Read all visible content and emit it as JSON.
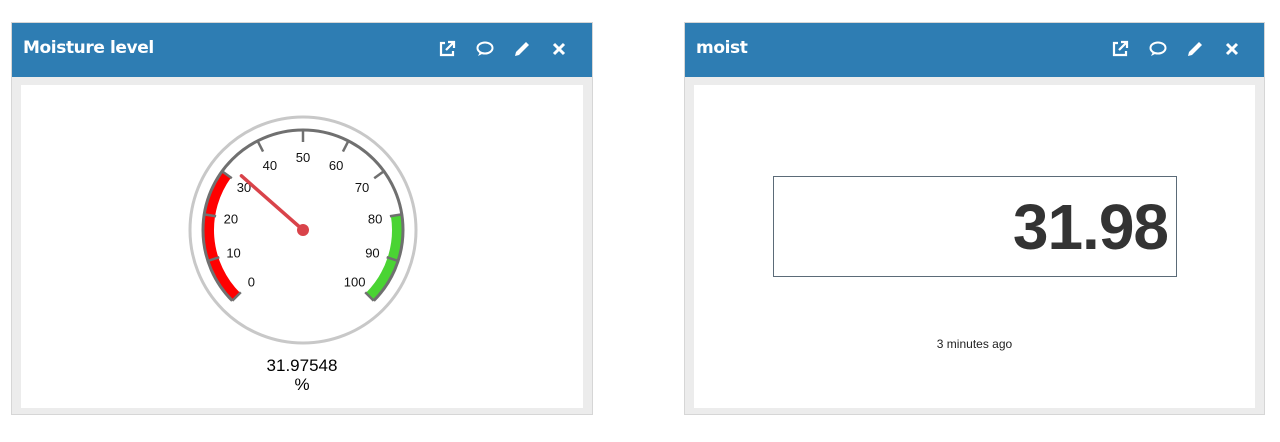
{
  "widgets": [
    {
      "title": "Moisture level",
      "type": "gauge",
      "value": "31.97548",
      "unit": "%",
      "gauge": {
        "min": 0,
        "max": 100,
        "major_ticks": [
          "0",
          "10",
          "20",
          "30",
          "40",
          "50",
          "60",
          "70",
          "80",
          "90",
          "100"
        ],
        "red_range": [
          0,
          30
        ],
        "green_range": [
          80,
          100
        ],
        "red_color": "#ff0000",
        "green_color": "#4ad433",
        "needle_color": "#d9434a"
      },
      "tools": [
        "external-link-icon",
        "comment-icon",
        "pencil-icon",
        "close-icon"
      ]
    },
    {
      "title": "moist",
      "type": "value",
      "value": "31.98",
      "timestamp": "3 minutes ago",
      "tools": [
        "external-link-icon",
        "comment-icon",
        "pencil-icon",
        "close-icon"
      ]
    }
  ],
  "colors": {
    "header": "#2e7db3",
    "value_text": "#333333"
  }
}
